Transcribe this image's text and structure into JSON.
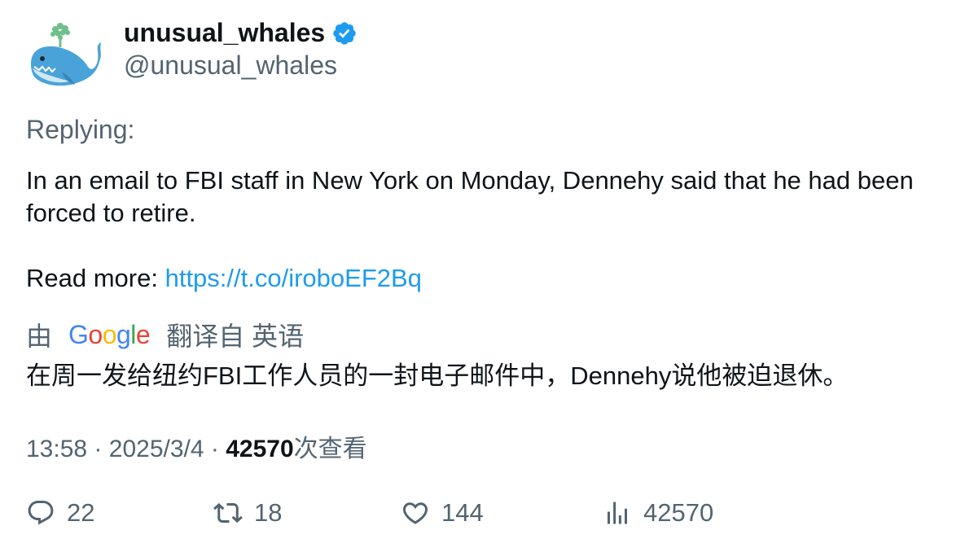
{
  "author": {
    "display_name": "unusual_whales",
    "handle": "@unusual_whales",
    "verified": true,
    "avatar_icon": "whale-avatar"
  },
  "tweet": {
    "replying_label": "Replying:",
    "text_line": "In an email to FBI staff in New York on Monday, Dennehy said that he had been forced to retire.",
    "read_more_label": "Read more:",
    "link": "https://t.co/iroboEF2Bq"
  },
  "translation": {
    "by_label": "由",
    "provider": "Google",
    "from_label": "翻译自 英语",
    "text": "在周一发给纽约FBI工作人员的一封电子邮件中，Dennehy说他被迫退休。"
  },
  "meta": {
    "time": "13:58",
    "separator": "·",
    "date": "2025/3/4",
    "views": "42570",
    "views_label": "次查看"
  },
  "actions": {
    "replies": "22",
    "retweets": "18",
    "likes": "144",
    "views": "42570"
  },
  "colors": {
    "text": "#0f1419",
    "secondary": "#536471",
    "link": "#1d9bf0",
    "verified": "#1d9bf0"
  }
}
